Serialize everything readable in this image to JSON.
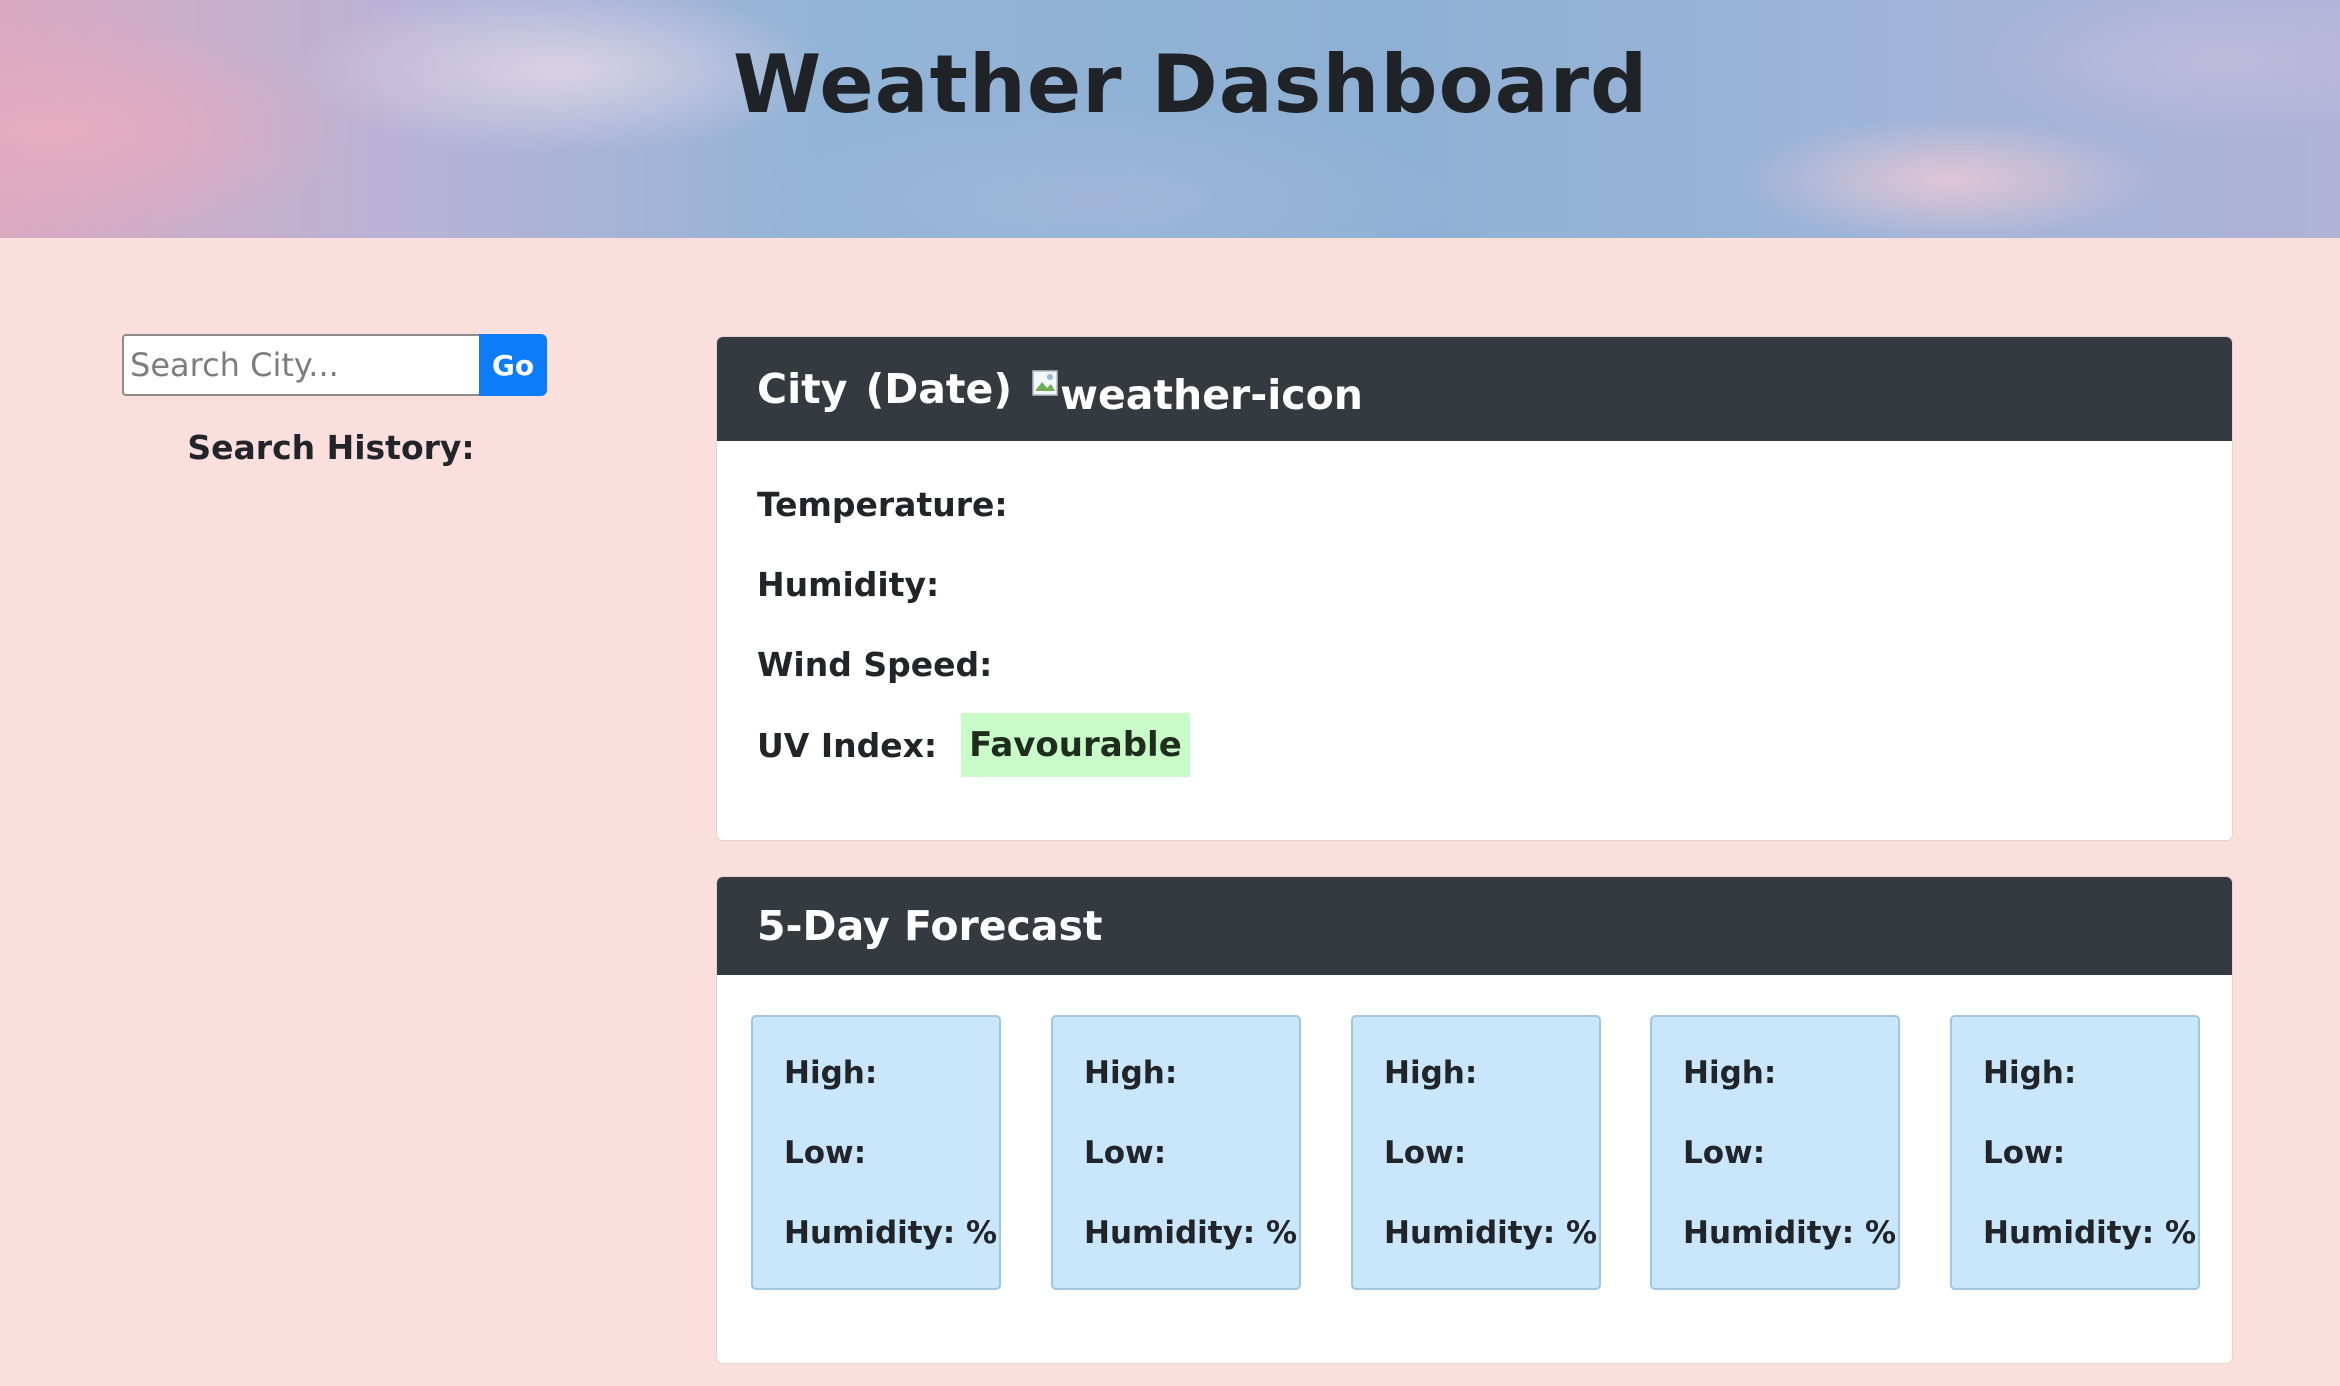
{
  "header": {
    "title": "Weather Dashboard"
  },
  "sidebar": {
    "search_placeholder": "Search City...",
    "search_value": "",
    "go_label": "Go",
    "history_title": "Search History:"
  },
  "current": {
    "city": "City",
    "date": "(Date)",
    "icon_alt": "weather-icon",
    "temperature_label": "Temperature:",
    "humidity_label": "Humidity:",
    "wind_label": "Wind Speed:",
    "uv_label": "UV Index:",
    "uv_badge": "Favourable",
    "uv_badge_color": "#c9fbc8"
  },
  "forecast": {
    "title": "5-Day Forecast",
    "days": [
      {
        "high": "High:",
        "low": "Low:",
        "humidity": "Humidity: %"
      },
      {
        "high": "High:",
        "low": "Low:",
        "humidity": "Humidity: %"
      },
      {
        "high": "High:",
        "low": "Low:",
        "humidity": "Humidity: %"
      },
      {
        "high": "High:",
        "low": "Low:",
        "humidity": "Humidity: %"
      },
      {
        "high": "High:",
        "low": "Low:",
        "humidity": "Humidity: %"
      }
    ]
  },
  "colors": {
    "page_background": "#fadfdc",
    "card_header": "#343a40",
    "go_button": "#0d7cf9",
    "forecast_day": "#c9e6fb"
  }
}
